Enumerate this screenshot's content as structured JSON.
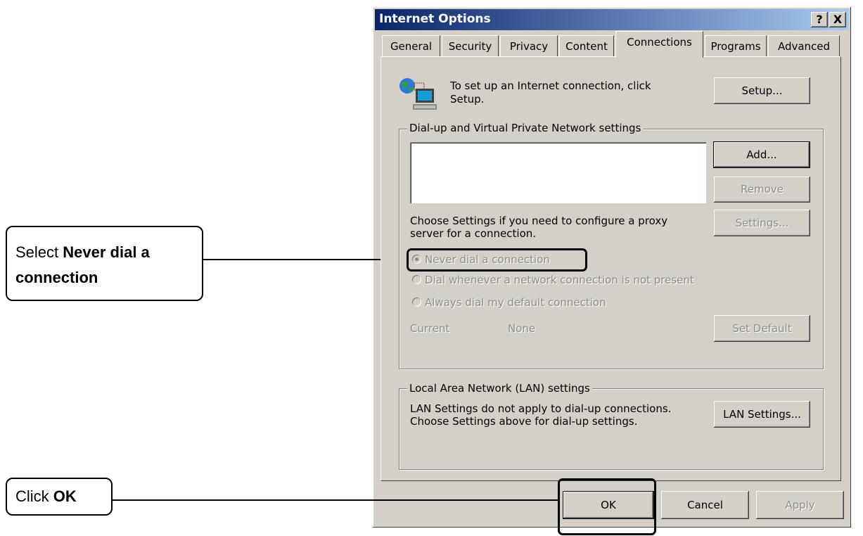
{
  "window": {
    "title": "Internet Options",
    "help_label": "?",
    "close_label": "X"
  },
  "tabs": [
    {
      "label": "General"
    },
    {
      "label": "Security"
    },
    {
      "label": "Privacy"
    },
    {
      "label": "Content"
    },
    {
      "label": "Connections"
    },
    {
      "label": "Programs"
    },
    {
      "label": "Advanced"
    }
  ],
  "active_tab": "Connections",
  "setup": {
    "text_line1": "To set up an Internet connection, click",
    "text_line2": "Setup.",
    "button": "Setup..."
  },
  "dialup": {
    "group_label": "Dial-up and Virtual Private Network settings",
    "add_button": "Add...",
    "remove_button": "Remove",
    "proxy_text_line1": "Choose Settings if you need to configure a proxy",
    "proxy_text_line2": "server for a connection.",
    "settings_button": "Settings...",
    "radio_options": [
      {
        "label": "Never dial a connection",
        "selected": true
      },
      {
        "label": "Dial whenever a network connection is not present",
        "selected": false
      },
      {
        "label": "Always dial my default connection",
        "selected": false
      }
    ],
    "current_label": "Current",
    "current_value": "None",
    "set_default_button": "Set Default"
  },
  "lan": {
    "group_label": "Local Area Network (LAN) settings",
    "text_line1": "LAN Settings do not apply to dial-up connections.",
    "text_line2": "Choose Settings above for dial-up settings.",
    "button": "LAN Settings..."
  },
  "footer": {
    "ok": "OK",
    "cancel": "Cancel",
    "apply": "Apply"
  },
  "callouts": {
    "never_dial": {
      "prefix": "Select ",
      "bold": "Never dial a",
      "line2": "connection"
    },
    "click_ok": {
      "prefix": "Click ",
      "bold": "OK"
    }
  },
  "colors": {
    "dialog_bg": "#d4d0c8",
    "title_start": "#0a246a",
    "title_end": "#a6caf0"
  }
}
